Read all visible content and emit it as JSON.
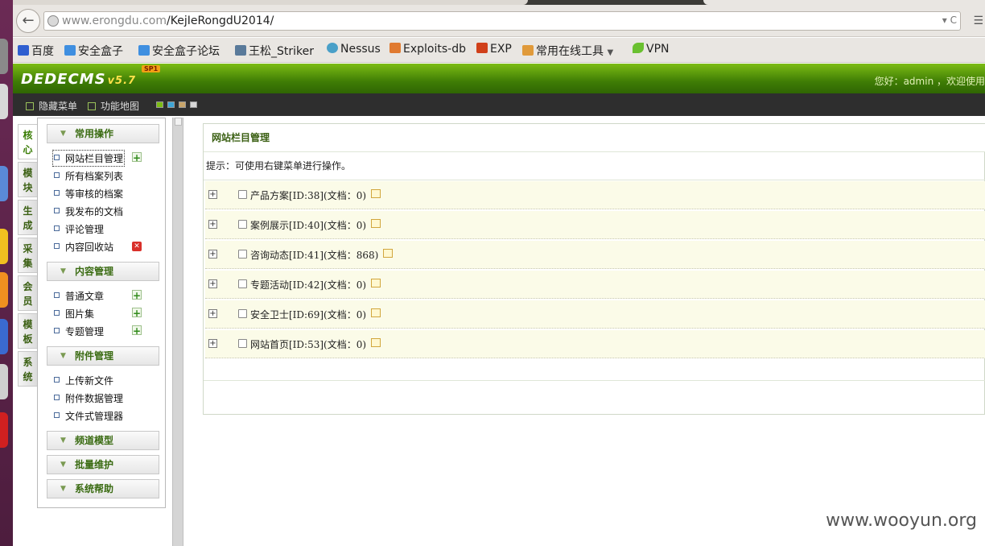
{
  "browser": {
    "url_host": "www.erongdu.com",
    "url_path": "/KejIeRongdU2014/",
    "bookmarks": [
      "百度",
      "安全盒子",
      "安全盒子论坛",
      "王松_Striker",
      "Nessus",
      "Exploits-db",
      "EXP",
      "常用在线工具",
      "VPN"
    ]
  },
  "header": {
    "logo": "DEDECMS",
    "version": "v5.7",
    "badge": "SP1",
    "greeting": "您好：admin ，欢迎使用"
  },
  "toolbar": {
    "hide_menu": "隐藏菜单",
    "site_map": "功能地图",
    "swatches": [
      "#7cbc14",
      "#3ea5d6",
      "#c7a46a",
      "#d8d8d8"
    ]
  },
  "vertical_tabs": [
    "核心",
    "模块",
    "生成",
    "采集",
    "会员",
    "模板",
    "系统"
  ],
  "sidebar": {
    "groups": [
      {
        "title": "常用操作",
        "items": [
          "网站栏目管理",
          "所有档案列表",
          "等审核的档案",
          "我发布的文档",
          "评论管理",
          "内容回收站"
        ]
      },
      {
        "title": "内容管理",
        "items": [
          "普通文章",
          "图片集",
          "专题管理"
        ]
      },
      {
        "title": "附件管理",
        "items": [
          "上传新文件",
          "附件数据管理",
          "文件式管理器"
        ]
      },
      {
        "title": "频道模型"
      },
      {
        "title": "批量维护"
      },
      {
        "title": "系统帮助"
      }
    ]
  },
  "main": {
    "title": "网站栏目管理",
    "tip": "提示：可使用右键菜单进行操作。",
    "categories": [
      {
        "label": "产品方案[ID:38](文档：0)"
      },
      {
        "label": "案例展示[ID:40](文档：0)"
      },
      {
        "label": "咨询动态[ID:41](文档：868)"
      },
      {
        "label": "专题活动[ID:42](文档：0)"
      },
      {
        "label": "安全卫士[ID:69](文档：0)"
      },
      {
        "label": "网站首页[ID:53](文档：0)"
      }
    ]
  },
  "watermark": "www.wooyun.org"
}
